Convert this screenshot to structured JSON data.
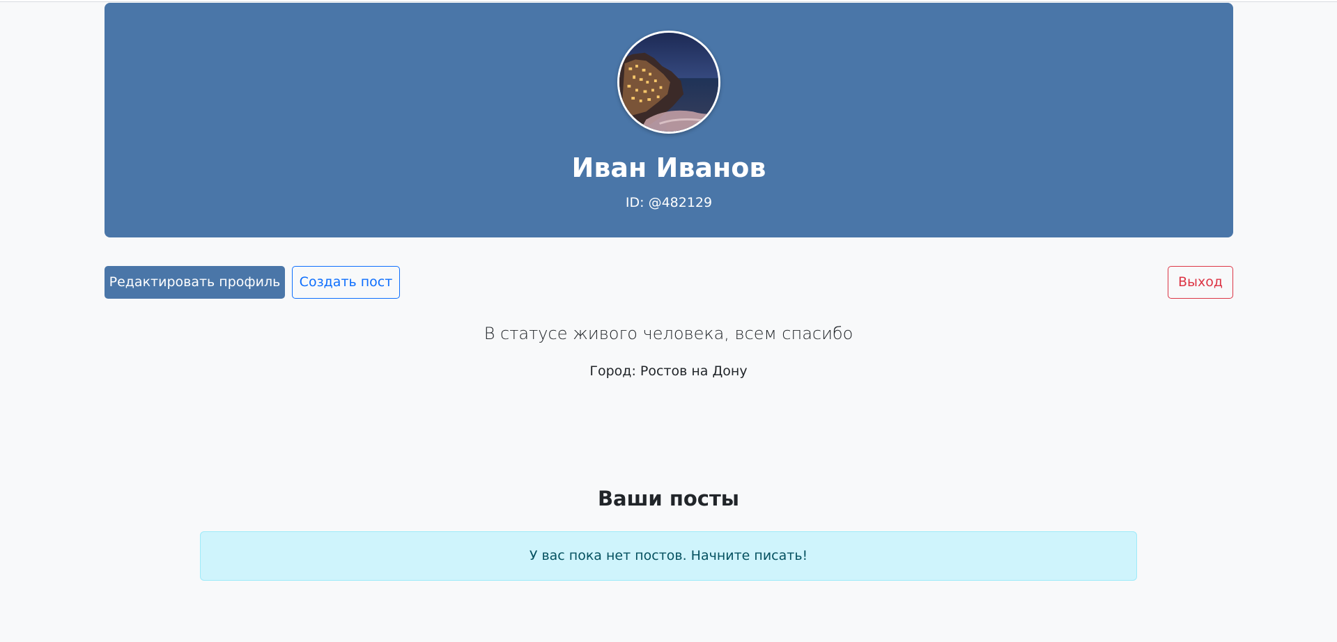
{
  "profile": {
    "avatar_icon": "avatar-photo-coastal-town-night",
    "name": "Иван Иванов",
    "id_label": "ID:",
    "id_value": "@482129"
  },
  "actions": {
    "edit_label": "Редактировать профиль",
    "create_label": "Создать пост",
    "logout_label": "Выход"
  },
  "about": {
    "status": "В статусе живого человека, всем спасибо",
    "city_label": "Город:",
    "city_value": "Ростов на Дону"
  },
  "posts": {
    "title": "Ваши посты",
    "empty_message": "У вас пока нет постов. Начните писать!"
  },
  "colors": {
    "hero_bg": "#4a76a8",
    "primary_outline": "#0d6efd",
    "danger_outline": "#dc3545",
    "info_bg": "#cff4fc"
  }
}
